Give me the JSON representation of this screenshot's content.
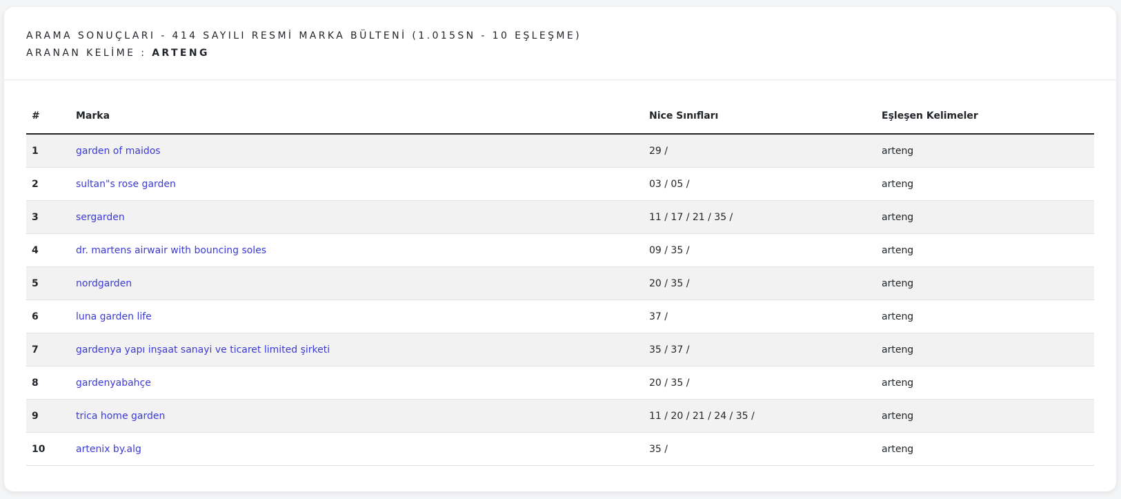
{
  "header": {
    "title_line": "ARAMA SONUÇLARI - 414 SAYILI RESMİ MARKA BÜLTENİ (1.015SN - 10 EŞLEŞME)",
    "search_label": "ARANAN KELİME : ",
    "search_term": "ARTENG"
  },
  "table": {
    "columns": [
      "#",
      "Marka",
      "Nice Sınıfları",
      "Eşleşen Kelimeler"
    ],
    "rows": [
      {
        "index": "1",
        "brand": "garden of maidos",
        "classes": "29 /",
        "matched": "arteng"
      },
      {
        "index": "2",
        "brand": "sultan\"s rose garden",
        "classes": "03 / 05 /",
        "matched": "arteng"
      },
      {
        "index": "3",
        "brand": "sergarden",
        "classes": "11 / 17 / 21 / 35 /",
        "matched": "arteng"
      },
      {
        "index": "4",
        "brand": "dr. martens airwair with bouncing soles",
        "classes": "09 / 35 /",
        "matched": "arteng"
      },
      {
        "index": "5",
        "brand": "nordgarden",
        "classes": "20 / 35 /",
        "matched": "arteng"
      },
      {
        "index": "6",
        "brand": "luna garden life",
        "classes": "37 /",
        "matched": "arteng"
      },
      {
        "index": "7",
        "brand": "gardenya yapı inşaat sanayi ve ticaret limited şirketi",
        "classes": "35 / 37 /",
        "matched": "arteng"
      },
      {
        "index": "8",
        "brand": "gardenyabahçe",
        "classes": "20 / 35 /",
        "matched": "arteng"
      },
      {
        "index": "9",
        "brand": "trica home garden",
        "classes": "11 / 20 / 21 / 24 / 35 /",
        "matched": "arteng"
      },
      {
        "index": "10",
        "brand": "artenix by.alg",
        "classes": "35 /",
        "matched": "arteng"
      }
    ]
  },
  "colors": {
    "link": "#3a3ad6",
    "stripe": "#f2f2f2",
    "text": "#212529"
  }
}
